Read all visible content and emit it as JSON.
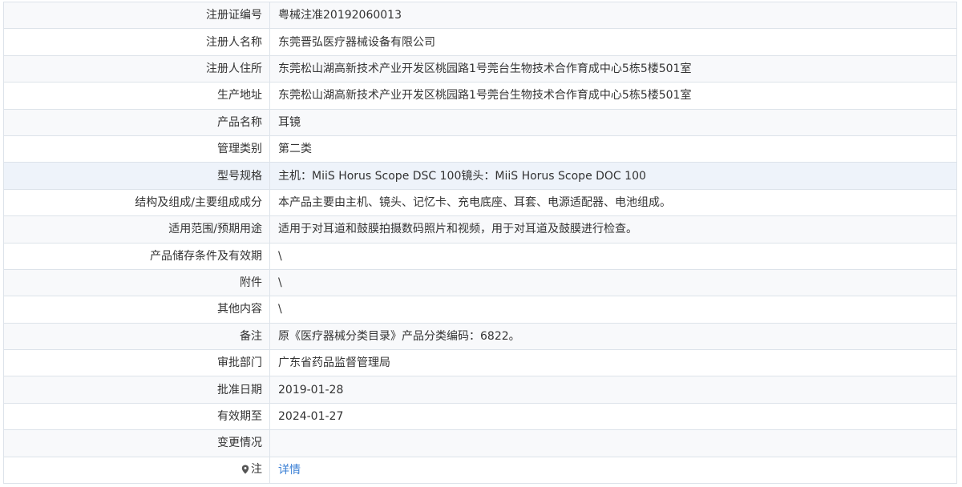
{
  "rows": [
    {
      "label": "注册证编号",
      "value": "粤械注准20192060013"
    },
    {
      "label": "注册人名称",
      "value": "东莞晋弘医疗器械设备有限公司"
    },
    {
      "label": "注册人住所",
      "value": "东莞松山湖高新技术产业开发区桃园路1号莞台生物技术合作育成中心5栋5楼501室"
    },
    {
      "label": "生产地址",
      "value": "东莞松山湖高新技术产业开发区桃园路1号莞台生物技术合作育成中心5栋5楼501室"
    },
    {
      "label": "产品名称",
      "value": "耳镜"
    },
    {
      "label": "管理类别",
      "value": "第二类"
    },
    {
      "label": "型号规格",
      "value": "主机：MiiS Horus Scope DSC 100镜头：MiiS Horus Scope DOC 100"
    },
    {
      "label": "结构及组成/主要组成成分",
      "value": "本产品主要由主机、镜头、记忆卡、充电底座、耳套、电源适配器、电池组成。"
    },
    {
      "label": "适用范围/预期用途",
      "value": "适用于对耳道和鼓膜拍摄数码照片和视频，用于对耳道及鼓膜进行检查。"
    },
    {
      "label": "产品储存条件及有效期",
      "value": "\\"
    },
    {
      "label": "附件",
      "value": "\\"
    },
    {
      "label": "其他内容",
      "value": "\\"
    },
    {
      "label": "备注",
      "value": "原《医疗器械分类目录》产品分类编码：6822。"
    },
    {
      "label": "审批部门",
      "value": "广东省药品监督管理局"
    },
    {
      "label": "批准日期",
      "value": "2019-01-28"
    },
    {
      "label": "有效期至",
      "value": "2024-01-27"
    },
    {
      "label": "变更情况",
      "value": ""
    }
  ],
  "note_row": {
    "label": "注",
    "icon": "map-pin-icon",
    "link_text": "详情"
  },
  "colors": {
    "border": "#dde3ea",
    "link": "#3a7fd5",
    "highlight_row": "#eef3fa"
  }
}
